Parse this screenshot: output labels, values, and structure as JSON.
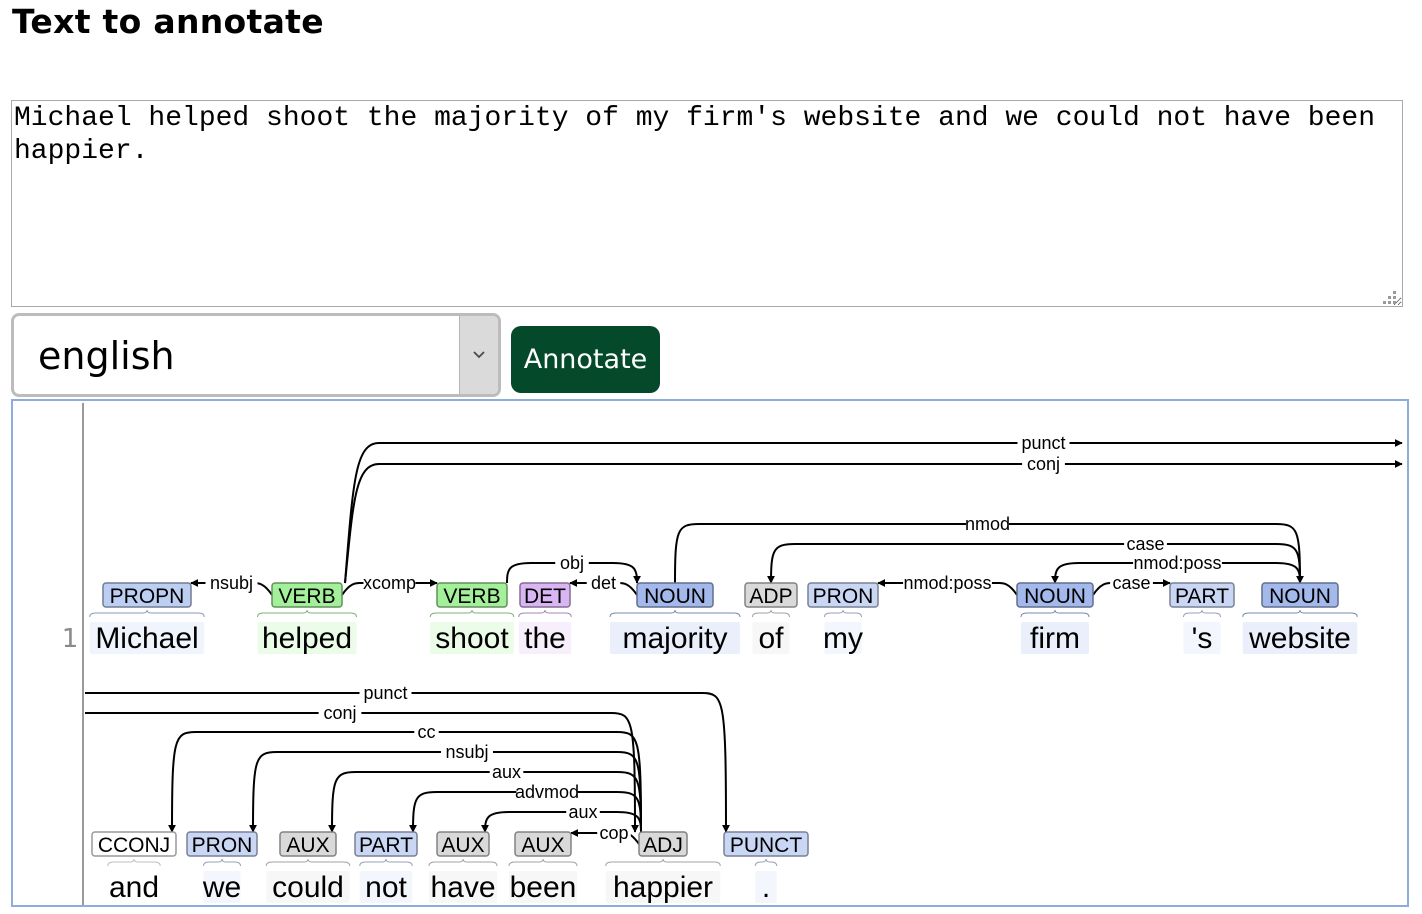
{
  "page": {
    "title": "Text to annotate"
  },
  "input": {
    "text": "Michael helped shoot the majority of my firm's website and we could not have been happier."
  },
  "language": {
    "selected": "english"
  },
  "annotate_button": {
    "label": "Annotate"
  },
  "colors": {
    "PROPN": "#bccff3",
    "VERB": "#a4f09a",
    "DET": "#d9b5f3",
    "NOUN": "#a3b8eb",
    "ADP": "#d9d9d9",
    "PRON": "#c9d7f5",
    "PART": "#c9d7f5",
    "CCONJ": "#ffffff",
    "AUX": "#d9d9d9",
    "ADJ": "#d9d9d9",
    "PUNCT": "#c9d7f5",
    "button": "#04492a",
    "frame_border": "#8eacdc"
  },
  "visualization": {
    "sentence_number": "1",
    "rows": [
      {
        "tokens": [
          {
            "word": "Michael",
            "tag": "PROPN"
          },
          {
            "word": "helped",
            "tag": "VERB"
          },
          {
            "word": "shoot",
            "tag": "VERB"
          },
          {
            "word": "the",
            "tag": "DET"
          },
          {
            "word": "majority",
            "tag": "NOUN"
          },
          {
            "word": "of",
            "tag": "ADP"
          },
          {
            "word": "my",
            "tag": "PRON"
          },
          {
            "word": "firm",
            "tag": "NOUN"
          },
          {
            "word": "'s",
            "tag": "PART"
          },
          {
            "word": "website",
            "tag": "NOUN"
          }
        ],
        "arcs": [
          {
            "label": "punct",
            "from": 1,
            "to": "out"
          },
          {
            "label": "conj",
            "from": 1,
            "to": "out"
          },
          {
            "label": "nmod",
            "from": 4,
            "to": 9
          },
          {
            "label": "case",
            "from": 9,
            "to": 5
          },
          {
            "label": "nmod:poss",
            "from": 9,
            "to": 7
          },
          {
            "label": "obj",
            "from": 2,
            "to": 4
          },
          {
            "label": "nsubj",
            "from": 1,
            "to": 0
          },
          {
            "label": "xcomp",
            "from": 1,
            "to": 2
          },
          {
            "label": "det",
            "from": 4,
            "to": 3
          },
          {
            "label": "nmod:poss",
            "from": 7,
            "to": 6
          },
          {
            "label": "case",
            "from": 7,
            "to": 8
          }
        ]
      },
      {
        "tokens": [
          {
            "word": "and",
            "tag": "CCONJ"
          },
          {
            "word": "we",
            "tag": "PRON"
          },
          {
            "word": "could",
            "tag": "AUX"
          },
          {
            "word": "not",
            "tag": "PART"
          },
          {
            "word": "have",
            "tag": "AUX"
          },
          {
            "word": "been",
            "tag": "AUX"
          },
          {
            "word": "happier",
            "tag": "ADJ"
          },
          {
            "word": ".",
            "tag": "PUNCT"
          }
        ],
        "arcs": [
          {
            "label": "punct",
            "from": "in",
            "to": 7
          },
          {
            "label": "conj",
            "from": "in",
            "to": 6
          },
          {
            "label": "cc",
            "from": 6,
            "to": 0
          },
          {
            "label": "nsubj",
            "from": 6,
            "to": 1
          },
          {
            "label": "aux",
            "from": 6,
            "to": 2
          },
          {
            "label": "advmod",
            "from": 6,
            "to": 3
          },
          {
            "label": "aux",
            "from": 6,
            "to": 4
          },
          {
            "label": "cop",
            "from": 6,
            "to": 5
          }
        ]
      }
    ]
  }
}
